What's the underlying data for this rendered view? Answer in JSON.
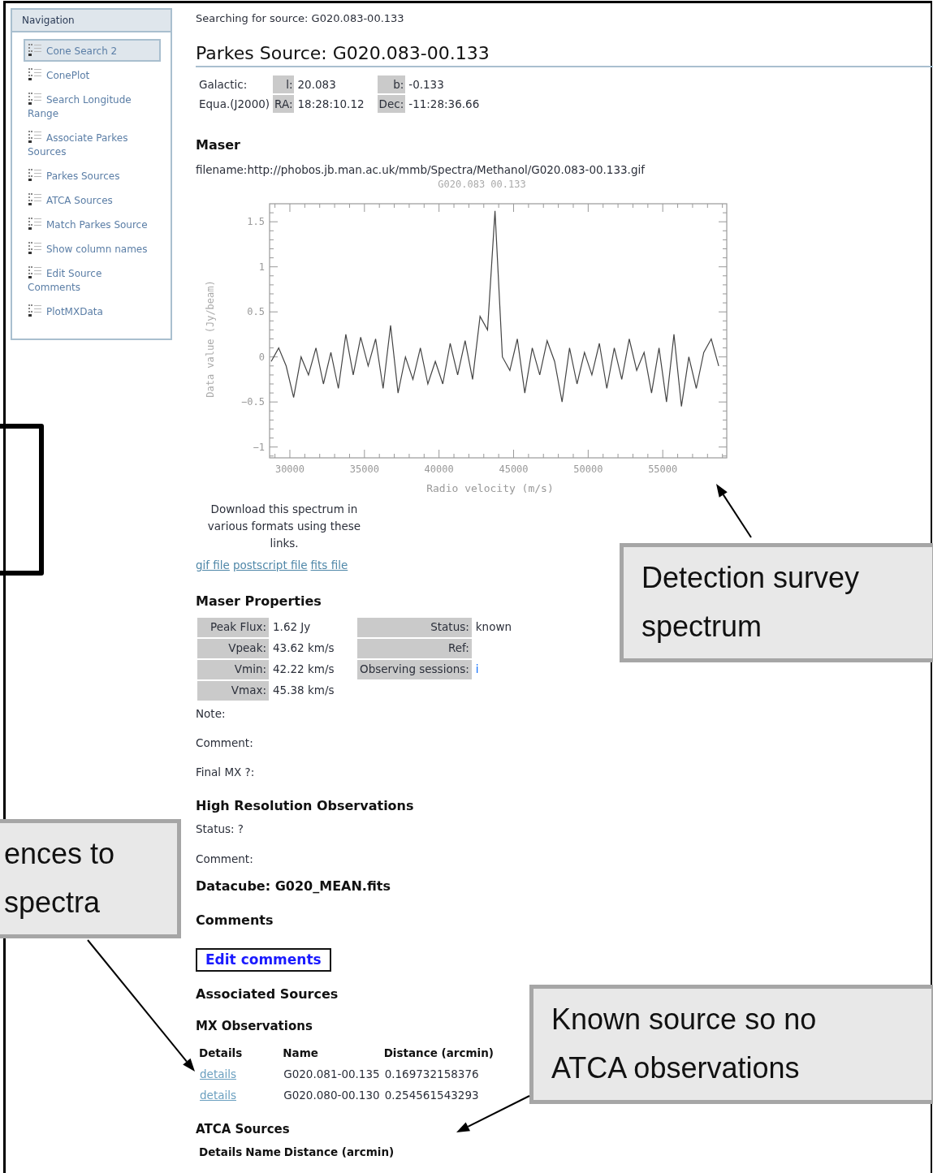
{
  "navigation": {
    "title": "Navigation",
    "items": [
      {
        "label": "Cone Search 2",
        "selected": true
      },
      {
        "label": "ConePlot",
        "selected": false
      },
      {
        "label": "Search Longitude Range",
        "selected": false
      },
      {
        "label": "Associate Parkes Sources",
        "selected": false
      },
      {
        "label": "Parkes Sources",
        "selected": false
      },
      {
        "label": "ATCA Sources",
        "selected": false
      },
      {
        "label": "Match Parkes Source",
        "selected": false
      },
      {
        "label": "Show column names",
        "selected": false
      },
      {
        "label": "Edit Source Comments",
        "selected": false
      },
      {
        "label": "PlotMXData",
        "selected": false
      }
    ]
  },
  "search_line": "Searching for source:  G020.083-00.133",
  "heading": "Parkes Source: G020.083-00.133",
  "coordinates": [
    {
      "system": "Galactic:",
      "fields": [
        {
          "label": "l:",
          "value": "20.083"
        },
        {
          "label": "b:",
          "value": "-0.133"
        }
      ]
    },
    {
      "system": "Equa.(J2000)",
      "fields": [
        {
          "label": "RA:",
          "value": "18:28:10.12"
        },
        {
          "label": "Dec:",
          "value": "-11:28:36.66"
        }
      ]
    }
  ],
  "maser": {
    "title": "Maser",
    "filename": "filename:http://phobos.jb.man.ac.uk/mmb/Spectra/Methanol/G020.083-00.133.gif",
    "chart_data": {
      "type": "line",
      "title": "G020.083 00.133",
      "xlabel": "Radio velocity (m/s)",
      "ylabel": "Data value (Jy/beam)",
      "xlim": [
        28640,
        59290
      ],
      "ylim": [
        -1.12,
        1.7
      ],
      "xticks": [
        30000,
        35000,
        40000,
        45000,
        50000,
        55000
      ],
      "yticks": [
        {
          "value": -1,
          "label": "−1"
        },
        {
          "value": -0.5,
          "label": "−0.5"
        },
        {
          "value": 0,
          "label": "0"
        },
        {
          "value": 0.5,
          "label": "0.5"
        },
        {
          "value": 1,
          "label": "1"
        },
        {
          "value": 1.5,
          "label": "1.5"
        }
      ],
      "x": [
        28750,
        29250,
        29750,
        30250,
        30750,
        31250,
        31750,
        32250,
        32750,
        33250,
        33750,
        34250,
        34750,
        35250,
        35750,
        36250,
        36750,
        37250,
        37750,
        38250,
        38750,
        39250,
        39750,
        40250,
        40750,
        41250,
        41750,
        42250,
        42750,
        43250,
        43750,
        44250,
        44750,
        45250,
        45750,
        46250,
        46750,
        47250,
        47750,
        48250,
        48750,
        49250,
        49750,
        50250,
        50750,
        51250,
        51750,
        52250,
        52750,
        53250,
        53750,
        54250,
        54750,
        55250,
        55750,
        56250,
        56750,
        57250,
        57750,
        58250,
        58750
      ],
      "series": [
        {
          "color": "#444444",
          "values": [
            -0.05,
            0.1,
            -0.1,
            -0.45,
            0.0,
            -0.2,
            0.1,
            -0.3,
            0.05,
            -0.35,
            0.25,
            -0.2,
            0.22,
            -0.1,
            0.2,
            -0.35,
            0.35,
            -0.4,
            0.0,
            -0.25,
            0.1,
            -0.3,
            -0.05,
            -0.3,
            0.15,
            -0.2,
            0.18,
            -0.25,
            0.45,
            0.3,
            1.62,
            0.0,
            -0.15,
            0.2,
            -0.4,
            0.1,
            -0.2,
            0.18,
            -0.05,
            -0.5,
            0.1,
            -0.3,
            0.05,
            -0.2,
            0.15,
            -0.35,
            0.1,
            -0.25,
            0.2,
            -0.15,
            0.05,
            -0.4,
            0.1,
            -0.5,
            0.25,
            -0.55,
            0.0,
            -0.35,
            0.05,
            0.2,
            -0.1
          ]
        }
      ]
    },
    "download_text": "Download this spectrum in various formats using these links.",
    "links": [
      "gif file",
      "postscript file",
      "fits file"
    ]
  },
  "maser_properties": {
    "title": "Maser Properties",
    "left": [
      {
        "label": "Peak Flux:",
        "value": "1.62   Jy"
      },
      {
        "label": "Vpeak:",
        "value": "43.62 km/s"
      },
      {
        "label": "Vmin:",
        "value": "42.22 km/s"
      },
      {
        "label": "Vmax:",
        "value": "45.38 km/s"
      }
    ],
    "right": [
      {
        "label": "Status:",
        "value": "known",
        "kind": "text"
      },
      {
        "label": "Ref:"
      },
      {
        "label": "Observing sessions:",
        "value": "i",
        "kind": "link"
      }
    ],
    "notes": [
      "Note:",
      "Comment:",
      "Final MX ?:"
    ]
  },
  "high_resolution": {
    "title": "High Resolution Observations",
    "status": "Status:  ?",
    "comment": "Comment:",
    "datacube": "Datacube: G020_MEAN.fits"
  },
  "comments": {
    "title": "Comments",
    "button": "Edit comments"
  },
  "associated": {
    "title": "Associated Sources",
    "mx": {
      "title": "MX Observations",
      "columns": [
        "Details",
        "Name",
        "Distance (arcmin)"
      ],
      "rows": [
        {
          "link": "details",
          "name": "G020.081-00.135",
          "distance": "0.169732158376"
        },
        {
          "link": "details",
          "name": "G020.080-00.130",
          "distance": "0.254561543293"
        }
      ]
    },
    "atca": {
      "title": "ATCA Sources",
      "columns": [
        "Details",
        "Name",
        "Distance (arcmin)"
      ]
    }
  },
  "callouts": [
    {
      "kind": "filled",
      "text": "Detection survey spectrum"
    },
    {
      "kind": "filled",
      "text": "ences to spectra"
    },
    {
      "kind": "filled",
      "text": "Known source so no ATCA observations"
    },
    {
      "kind": "outline"
    }
  ]
}
